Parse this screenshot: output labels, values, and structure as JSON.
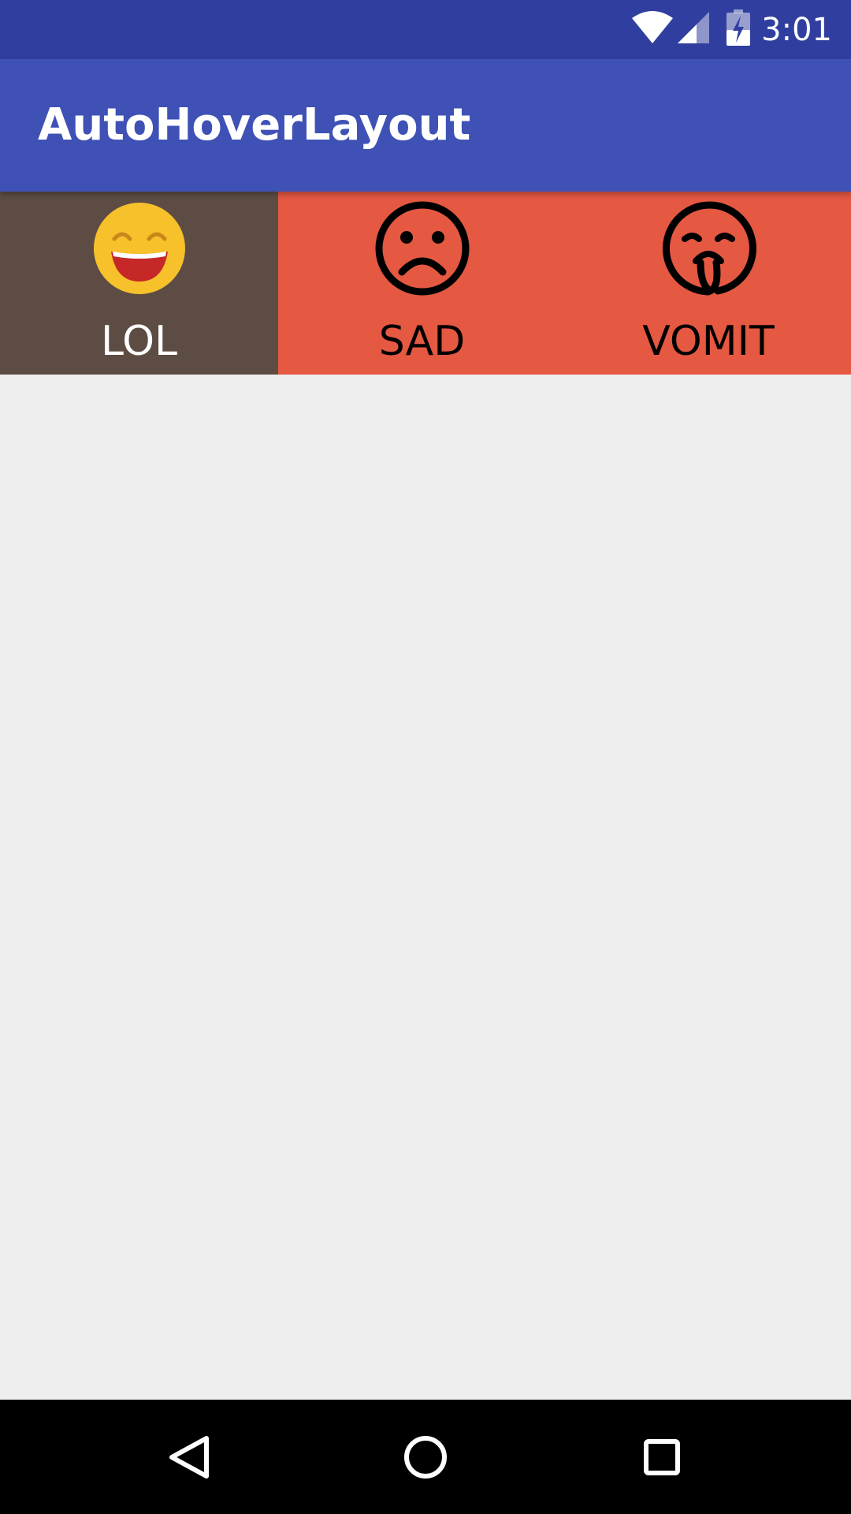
{
  "status_bar": {
    "time": "3:01",
    "icons": [
      "wifi-icon",
      "cell-signal-icon",
      "battery-charging-icon"
    ]
  },
  "app_bar": {
    "title": "AutoHoverLayout"
  },
  "tabs": [
    {
      "label": "LOL",
      "icon": "laughing-face-icon",
      "active": true
    },
    {
      "label": "SAD",
      "icon": "sad-face-icon",
      "active": false
    },
    {
      "label": "VOMIT",
      "icon": "vomit-face-icon",
      "active": false
    }
  ],
  "colors": {
    "status_bar": "#303f9f",
    "app_bar": "#3f51b5",
    "tab_active": "#5d4c44",
    "tab_inactive": "#e55842",
    "content_bg": "#eeeeee",
    "nav_bar": "#000000"
  },
  "nav_bar": {
    "buttons": [
      "back-icon",
      "home-icon",
      "recents-icon"
    ]
  }
}
